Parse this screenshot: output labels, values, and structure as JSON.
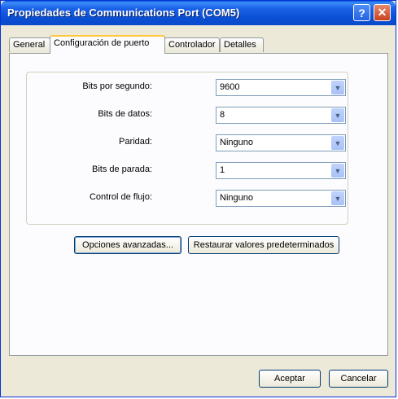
{
  "window": {
    "title": "Propiedades de Communications Port (COM5)",
    "help_glyph": "?",
    "close_glyph": "✕"
  },
  "tabs": [
    "General",
    "Configuración de puerto",
    "Controlador",
    "Detalles"
  ],
  "settings": [
    {
      "label": "Bits por segundo:",
      "value": "9600"
    },
    {
      "label": "Bits de datos:",
      "value": "8"
    },
    {
      "label": "Paridad:",
      "value": "Ninguno"
    },
    {
      "label": "Bits de parada:",
      "value": "1"
    },
    {
      "label": "Control de flujo:",
      "value": "Ninguno"
    }
  ],
  "buttons": {
    "advanced": "Opciones avanzadas...",
    "restore": "Restaurar valores predeterminados",
    "accept": "Aceptar",
    "cancel": "Cancelar"
  }
}
